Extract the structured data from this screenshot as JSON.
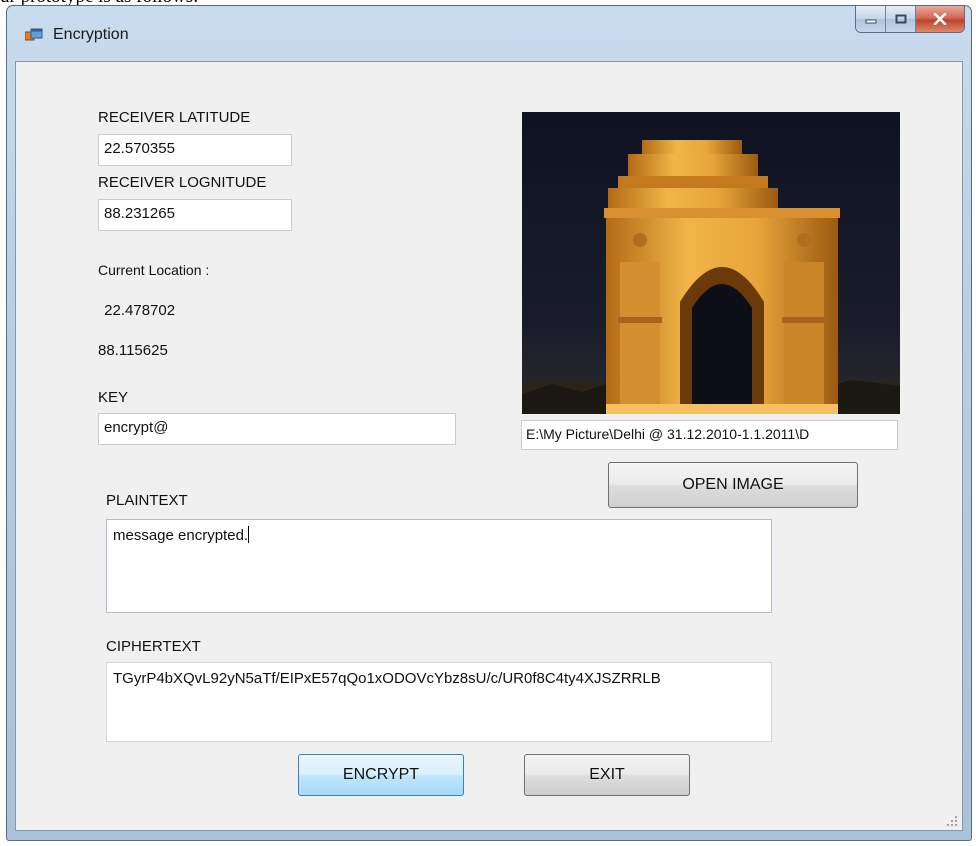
{
  "document_snippet": "ur prototype is as follows:",
  "window": {
    "title": "Encryption",
    "app_icon": "form-icon",
    "caption_buttons": [
      "minimize-icon",
      "maximize-icon",
      "close-icon"
    ]
  },
  "form": {
    "receiver_latitude": {
      "label": "RECEIVER LATITUDE",
      "value": "22.570355"
    },
    "receiver_longitude": {
      "label": "RECEIVER LOGNITUDE",
      "value": "88.231265"
    },
    "current_location": {
      "label": "Current Location :",
      "latitude": " 22.478702",
      "longitude": "88.115625"
    },
    "key": {
      "label": "KEY",
      "value": "encrypt@"
    },
    "image_path": "E:\\My Picture\\Delhi @ 31.12.2010-1.1.2011\\D",
    "open_image_button": "OPEN IMAGE",
    "plaintext": {
      "label": "PLAINTEXT",
      "value": "message encrypted."
    },
    "ciphertext": {
      "label": "CIPHERTEXT",
      "value": "TGyrP4bXQvL92yN5aTf/EIPxE57qQo1xODOVcYbz8sU/c/UR0f8C4ty4XJSZRRLB"
    },
    "encrypt_button": "ENCRYPT",
    "exit_button": "EXIT",
    "picture": "india-gate-night-photo"
  },
  "colors": {
    "client_background": "#f0f0f0",
    "titlebar": "#b9cfe5",
    "close_button": "#c8452d",
    "default_button": "#bee6fd"
  }
}
